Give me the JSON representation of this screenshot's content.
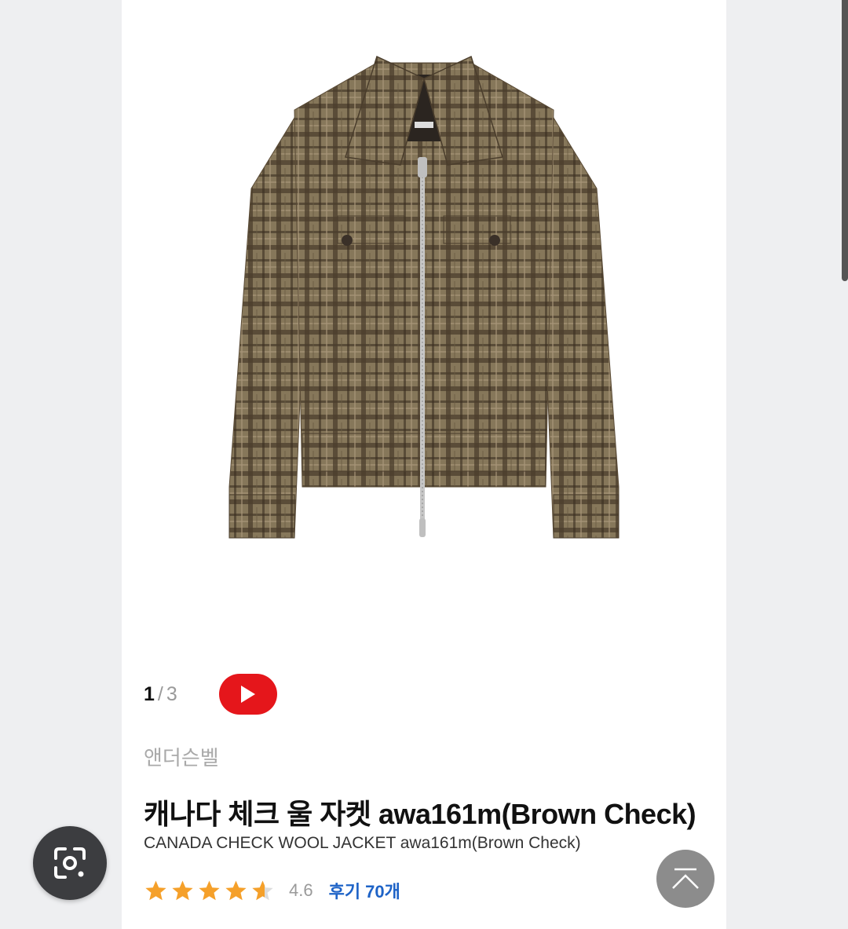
{
  "pager": {
    "current": "1",
    "separator": "/",
    "total": "3"
  },
  "product": {
    "brand": "앤더슨벨",
    "title_ko": "캐나다 체크 울 자켓 awa161m(Brown Check)",
    "title_en": "CANADA CHECK WOOL JACKET awa161m(Brown Check)",
    "image_icon": "plaid-jacket-image",
    "tag_text": "Andersson Bell"
  },
  "rating": {
    "stars": 4.6,
    "score": "4.6",
    "reviews": "후기 70개"
  },
  "colors": {
    "play": "#e5161b",
    "review_link": "#1e63c7",
    "star": "#f5a02a",
    "jacket": "#7d6d50"
  },
  "icons": {
    "lens": "google-lens-icon",
    "top": "scroll-top-icon",
    "play": "play-icon"
  }
}
